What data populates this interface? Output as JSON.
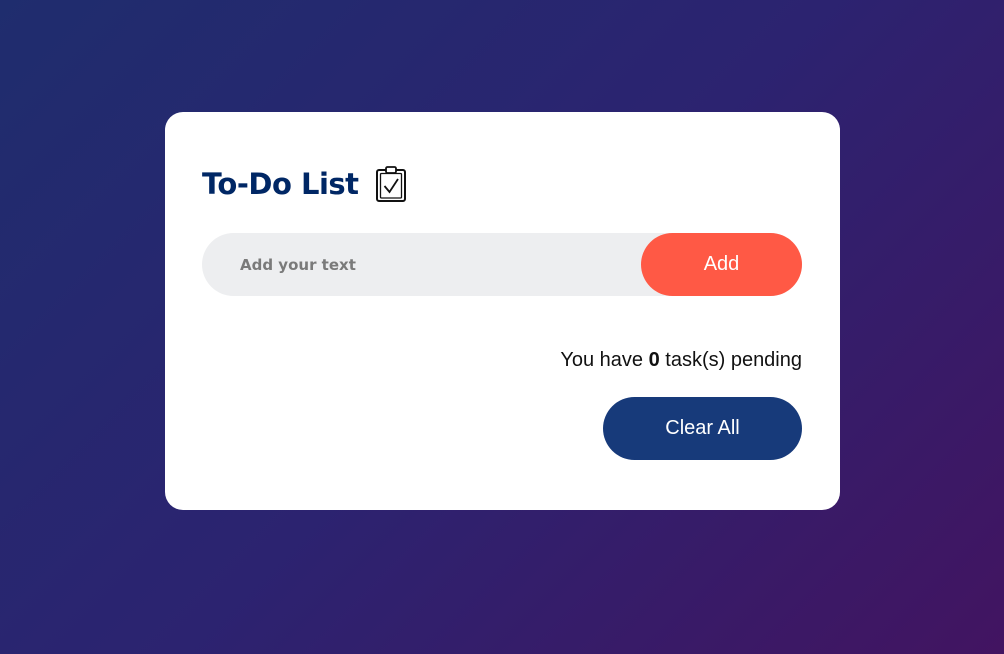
{
  "app": {
    "title": "To-Do List",
    "title_icon": "clipboard-check-icon"
  },
  "task_input": {
    "value": "",
    "placeholder": "Add your text"
  },
  "add_button": {
    "label": "Add"
  },
  "pending": {
    "prefix": "You have ",
    "count": "0",
    "suffix": " task(s) pending"
  },
  "clear_button": {
    "label": "Clear All"
  },
  "colors": {
    "title": "#002765",
    "add_button": "#ff5945",
    "clear_button": "#173a7a",
    "input_background": "#edeef0",
    "card_background": "#ffffff"
  }
}
